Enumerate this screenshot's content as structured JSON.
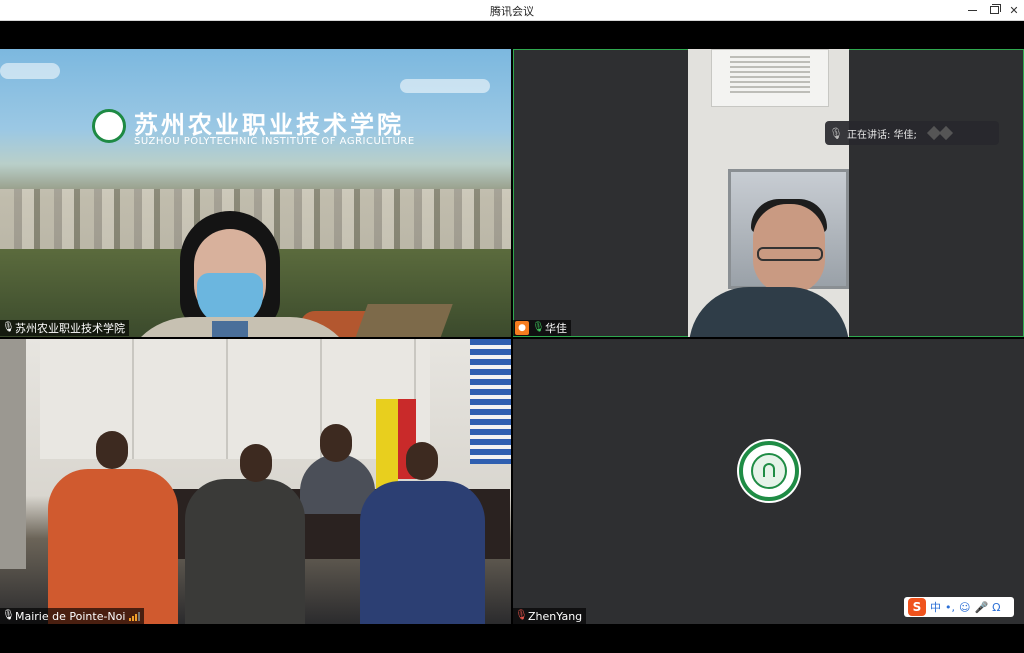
{
  "window": {
    "title": "腾讯会议",
    "minimize_glyph": "",
    "maximize_glyph": "",
    "close_glyph": "✕"
  },
  "tiles": [
    {
      "id": "tile-1",
      "name": "苏州农业职业技术学院",
      "mic_state": "muted-white",
      "banner_cn": "苏州农业职业技术学院",
      "banner_en": "SUZHOU POLYTECHNIC INSTITUTE OF AGRICULTURE"
    },
    {
      "id": "tile-2",
      "name": "华佳",
      "mic_state": "active-green",
      "is_host": true,
      "speaking_label": "正在讲话: 华佳;"
    },
    {
      "id": "tile-3",
      "name": "Mairie de Pointe-Noi",
      "mic_state": "muted-white",
      "signal": "weak"
    },
    {
      "id": "tile-4",
      "name": "ZhenYang",
      "mic_state": "muted-red"
    }
  ],
  "ime_toolbar": {
    "logo": "S",
    "mode": "中",
    "punct": "•,",
    "emoji_icon": "smiley-icon",
    "voice_icon": "microphone-icon",
    "headset_icon": "headset-icon"
  },
  "colors": {
    "active_speaker_border": "#2fa84f",
    "host_badge": "#f57c1f",
    "mic_active": "#3ec45a",
    "mic_muted_red": "#e8544a",
    "ime_brand": "#f0531d"
  }
}
